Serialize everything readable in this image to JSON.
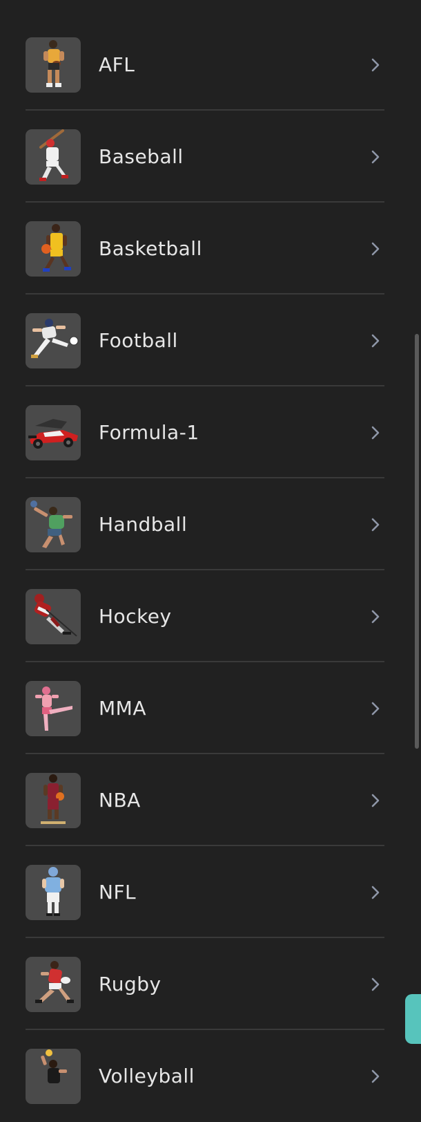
{
  "sports": [
    {
      "label": "AFL",
      "icon": "afl-player-icon"
    },
    {
      "label": "Baseball",
      "icon": "baseball-player-icon"
    },
    {
      "label": "Basketball",
      "icon": "basketball-player-icon"
    },
    {
      "label": "Football",
      "icon": "football-player-icon"
    },
    {
      "label": "Formula-1",
      "icon": "formula-1-car-icon"
    },
    {
      "label": "Handball",
      "icon": "handball-player-icon"
    },
    {
      "label": "Hockey",
      "icon": "hockey-player-icon"
    },
    {
      "label": "MMA",
      "icon": "mma-fighter-icon"
    },
    {
      "label": "NBA",
      "icon": "nba-player-icon"
    },
    {
      "label": "NFL",
      "icon": "nfl-player-icon"
    },
    {
      "label": "Rugby",
      "icon": "rugby-player-icon"
    },
    {
      "label": "Volleyball",
      "icon": "volleyball-player-icon"
    }
  ],
  "colors": {
    "background": "#212121",
    "thumb_background": "#4a4a4a",
    "divider": "#3a3a3a",
    "text": "#e6e6e6",
    "chevron": "#8f97a8",
    "fab": "#57c4bc"
  }
}
